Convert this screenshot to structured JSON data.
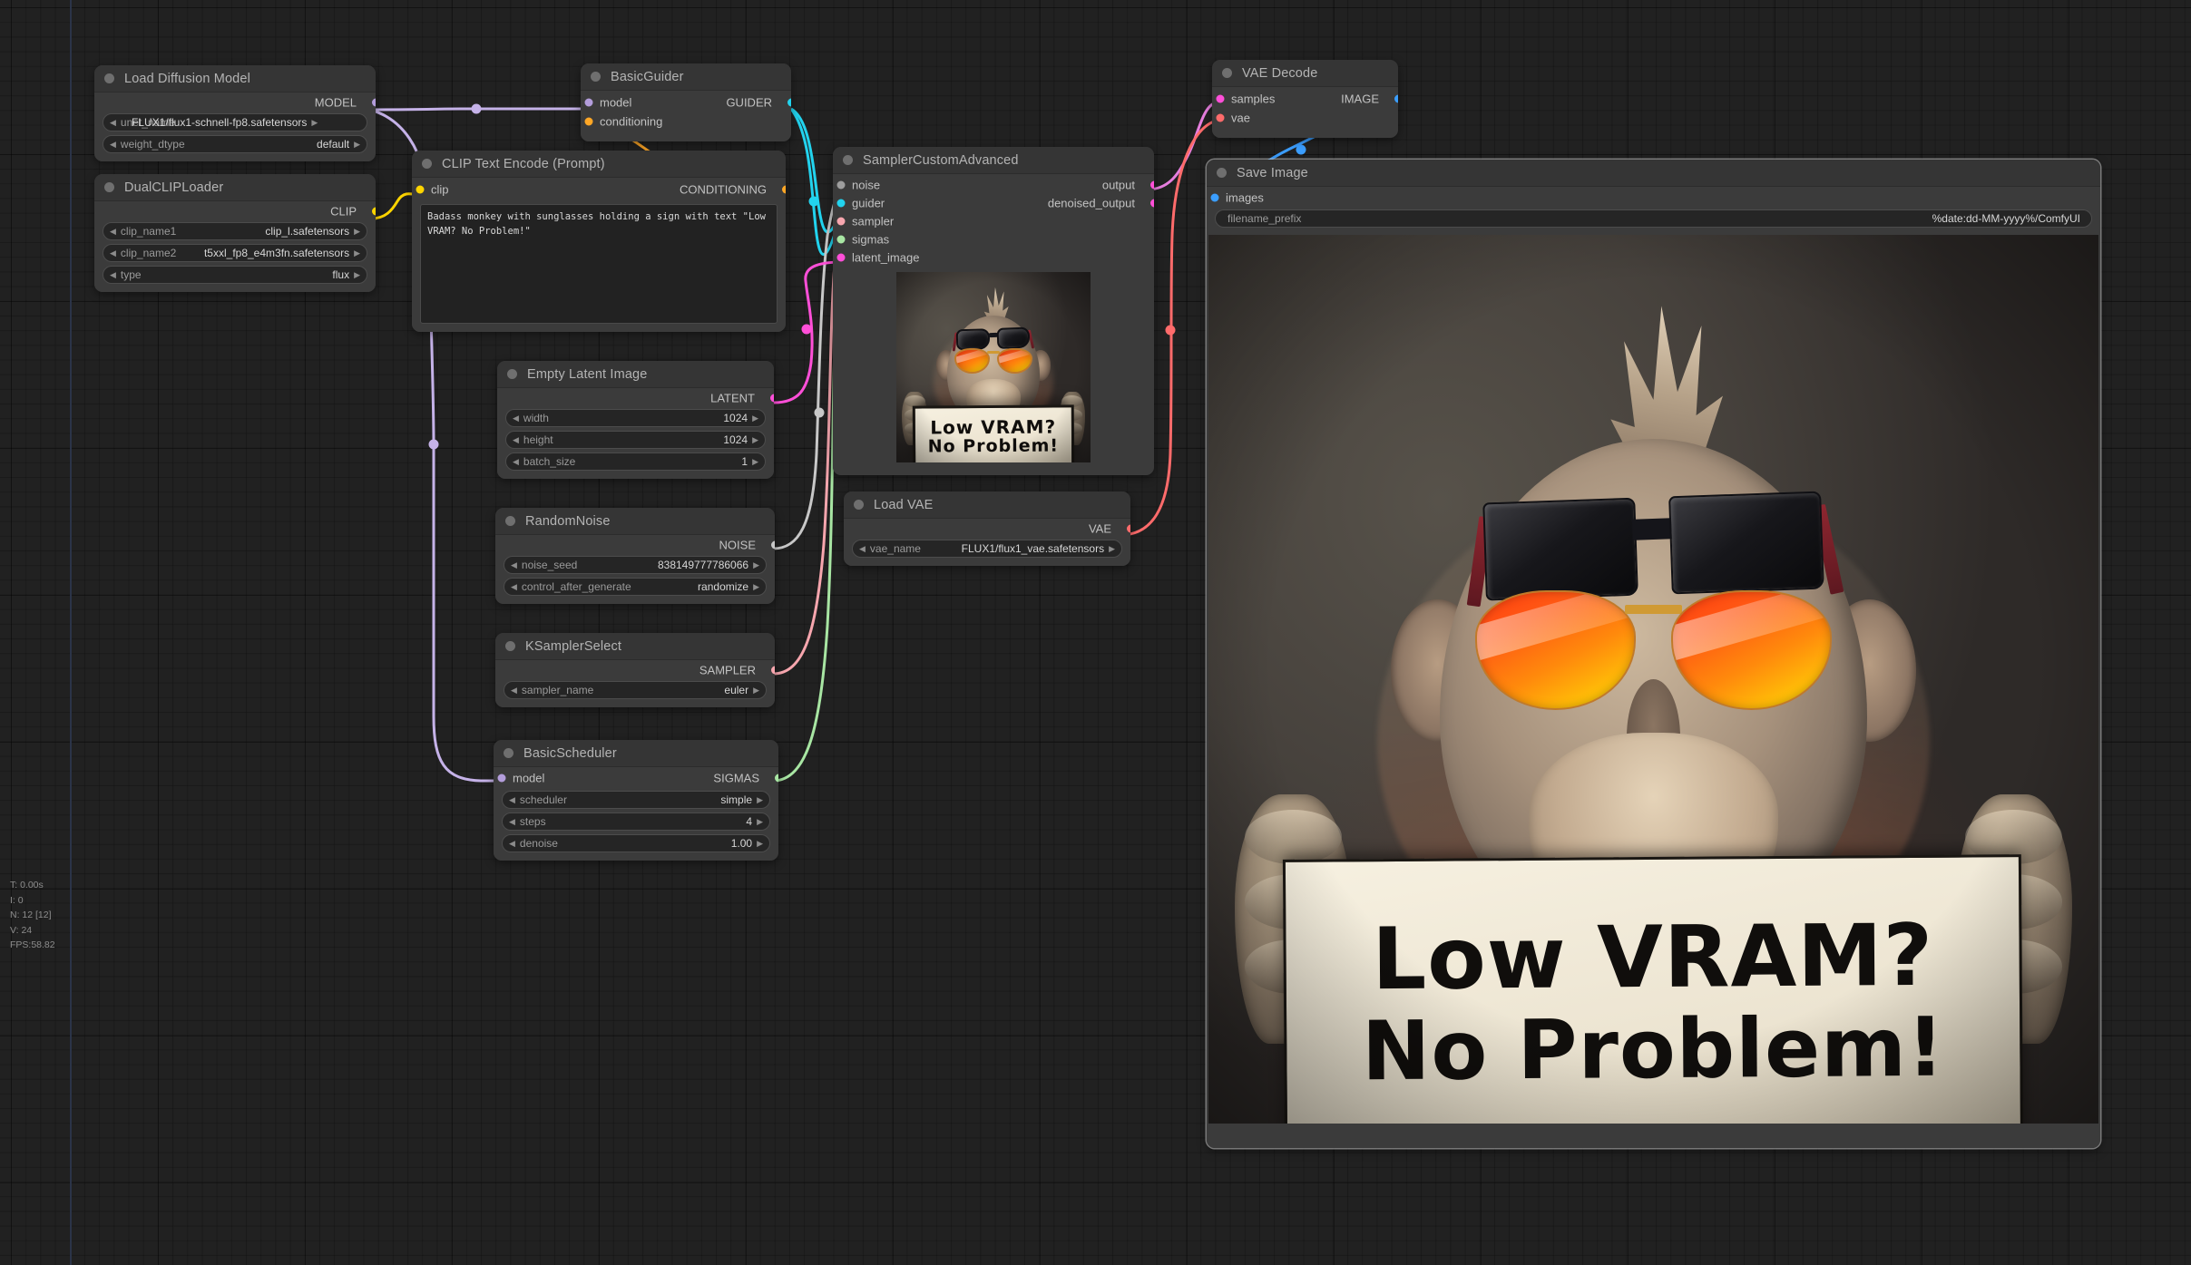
{
  "app": {
    "name": "ComfyUI",
    "canvas_bg": "#212121"
  },
  "stats": {
    "time": "T: 0.00s",
    "iterations": "I: 0",
    "nodes": "N: 12 [12]",
    "version": "V: 24",
    "fps": "FPS:58.82"
  },
  "nodes": {
    "load_diffusion_model": {
      "title": "Load Diffusion Model",
      "outputs": [
        {
          "label": "MODEL",
          "color": "#b39ddb"
        }
      ],
      "widgets": [
        {
          "label": "unet_name",
          "value": "FLUX1/flux1-schnell-fp8.safetensors"
        },
        {
          "label": "weight_dtype",
          "value": "default"
        }
      ]
    },
    "dual_clip_loader": {
      "title": "DualCLIPLoader",
      "outputs": [
        {
          "label": "CLIP",
          "color": "#ffd500"
        }
      ],
      "widgets": [
        {
          "label": "clip_name1",
          "value": "clip_l.safetensors"
        },
        {
          "label": "clip_name2",
          "value": "t5xxl_fp8_e4m3fn.safetensors"
        },
        {
          "label": "type",
          "value": "flux"
        }
      ]
    },
    "basic_guider": {
      "title": "BasicGuider",
      "inputs": [
        {
          "label": "model",
          "color": "#b39ddb"
        },
        {
          "label": "conditioning",
          "color": "#ffa726"
        }
      ],
      "outputs": [
        {
          "label": "GUIDER",
          "color": "#22d3ee"
        }
      ]
    },
    "clip_text_encode": {
      "title": "CLIP Text Encode (Prompt)",
      "inputs": [
        {
          "label": "clip",
          "color": "#ffd500"
        }
      ],
      "outputs": [
        {
          "label": "CONDITIONING",
          "color": "#ffa726"
        }
      ],
      "prompt": "Badass monkey with sunglasses holding a sign with text \"Low VRAM? No Problem!\""
    },
    "empty_latent_image": {
      "title": "Empty Latent Image",
      "outputs": [
        {
          "label": "LATENT",
          "color": "#ff4fd8"
        }
      ],
      "widgets": [
        {
          "label": "width",
          "value": "1024"
        },
        {
          "label": "height",
          "value": "1024"
        },
        {
          "label": "batch_size",
          "value": "1"
        }
      ]
    },
    "random_noise": {
      "title": "RandomNoise",
      "outputs": [
        {
          "label": "NOISE",
          "color": "#c8c8c8"
        }
      ],
      "widgets": [
        {
          "label": "noise_seed",
          "value": "838149777786066"
        },
        {
          "label": "control_after_generate",
          "value": "randomize"
        }
      ]
    },
    "ksampler_select": {
      "title": "KSamplerSelect",
      "outputs": [
        {
          "label": "SAMPLER",
          "color": "#f7a6ae"
        }
      ],
      "widgets": [
        {
          "label": "sampler_name",
          "value": "euler"
        }
      ]
    },
    "basic_scheduler": {
      "title": "BasicScheduler",
      "inputs": [
        {
          "label": "model",
          "color": "#b39ddb"
        }
      ],
      "outputs": [
        {
          "label": "SIGMAS",
          "color": "#a8e6a3"
        }
      ],
      "widgets": [
        {
          "label": "scheduler",
          "value": "simple"
        },
        {
          "label": "steps",
          "value": "4"
        },
        {
          "label": "denoise",
          "value": "1.00"
        }
      ]
    },
    "sampler_custom_advanced": {
      "title": "SamplerCustomAdvanced",
      "inputs": [
        {
          "label": "noise",
          "color": "#9e9e9e"
        },
        {
          "label": "guider",
          "color": "#22d3ee"
        },
        {
          "label": "sampler",
          "color": "#f7a6ae"
        },
        {
          "label": "sigmas",
          "color": "#a8e6a3"
        },
        {
          "label": "latent_image",
          "color": "#ff4fd8"
        }
      ],
      "outputs": [
        {
          "label": "output",
          "color": "#ff4fd8"
        },
        {
          "label": "denoised_output",
          "color": "#ff4fd8"
        }
      ],
      "preview": {
        "sign_line1": "Low VRAM?",
        "sign_line2": "No Problem!"
      }
    },
    "load_vae": {
      "title": "Load VAE",
      "outputs": [
        {
          "label": "VAE",
          "color": "#ff6b6b"
        }
      ],
      "widgets": [
        {
          "label": "vae_name",
          "value": "FLUX1/flux1_vae.safetensors"
        }
      ]
    },
    "vae_decode": {
      "title": "VAE Decode",
      "inputs": [
        {
          "label": "samples",
          "color": "#ff4fd8"
        },
        {
          "label": "vae",
          "color": "#ff6b6b"
        }
      ],
      "outputs": [
        {
          "label": "IMAGE",
          "color": "#3b9eff"
        }
      ]
    },
    "save_image": {
      "title": "Save Image",
      "inputs": [
        {
          "label": "images",
          "color": "#3b9eff"
        }
      ],
      "widgets": [
        {
          "label": "filename_prefix",
          "value": "%date:dd-MM-yyyy%/ComfyUI"
        }
      ],
      "preview": {
        "sign_line1": "Low VRAM?",
        "sign_line2": "No Problem!"
      }
    }
  },
  "link_colors": {
    "model": "#c5b2e8",
    "clip": "#ffd500",
    "conditioning": "#ffa726",
    "guider": "#22d3ee",
    "noise": "#c8c8c8",
    "sampler": "#f7a6ae",
    "sigmas": "#a8e6a3",
    "latent": "#ff4fd8",
    "vae": "#ff6b6b",
    "image": "#3b9eff"
  }
}
